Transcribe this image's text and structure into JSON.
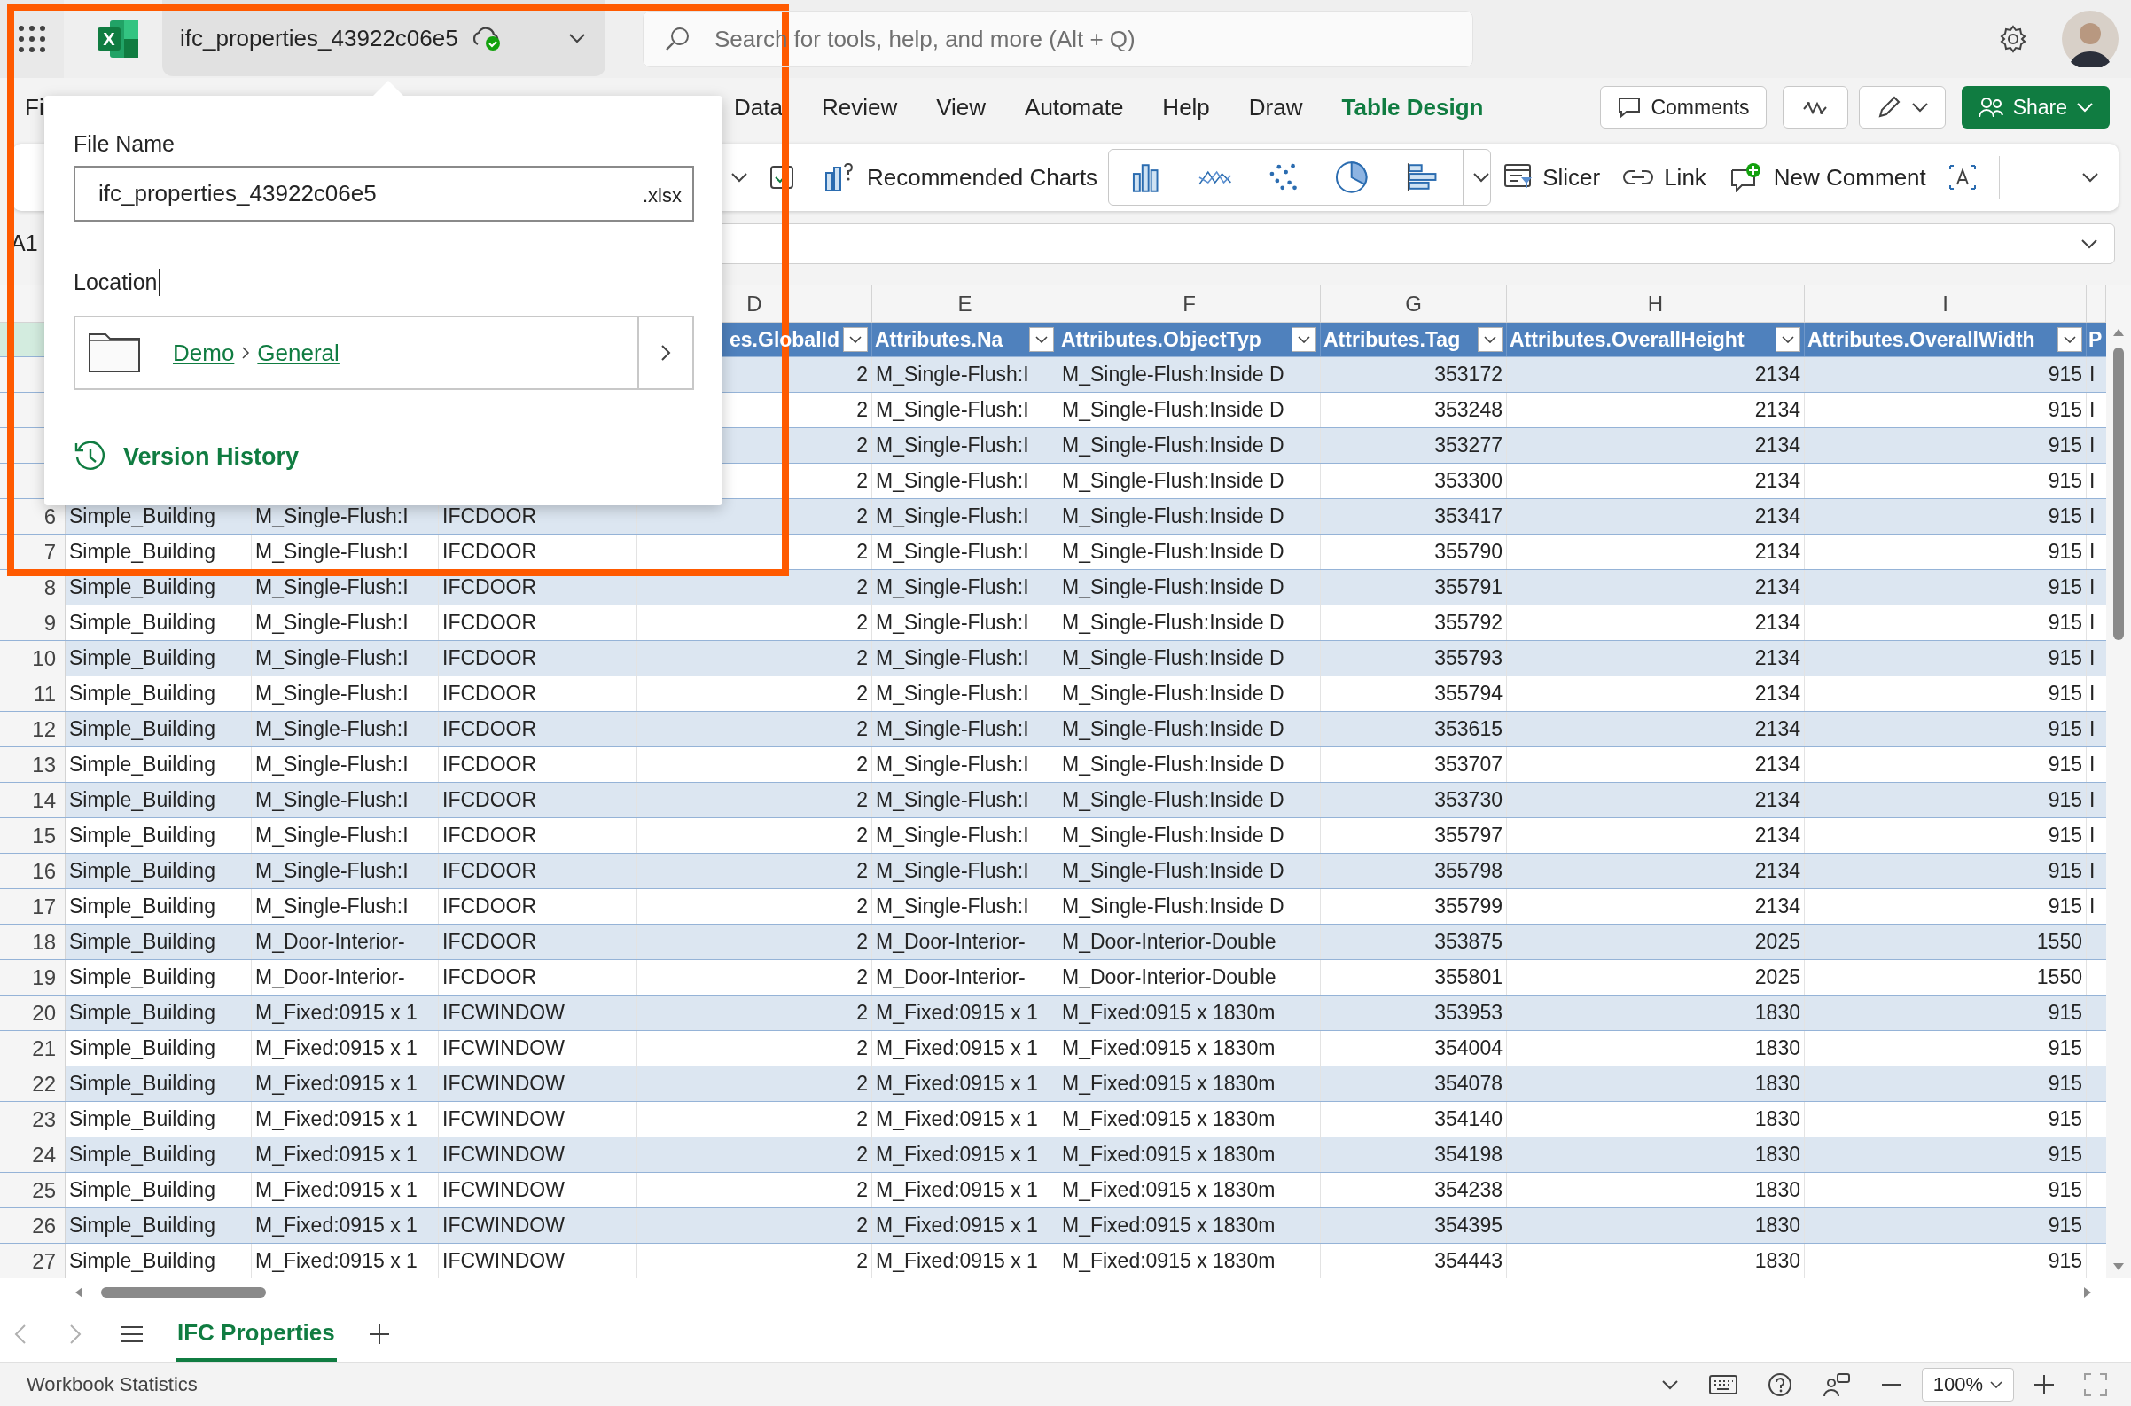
{
  "app_bar": {
    "logo_letter": "X",
    "file_name": "ifc_properties_43922c06e5",
    "search": {
      "placeholder": "Search for tools, help, and more (Alt + Q)"
    }
  },
  "ribbon_tabs": [
    {
      "label": "Fi",
      "selected": false
    },
    {
      "label": "Data",
      "selected": false
    },
    {
      "label": "Review",
      "selected": false
    },
    {
      "label": "View",
      "selected": false
    },
    {
      "label": "Automate",
      "selected": false
    },
    {
      "label": "Help",
      "selected": false
    },
    {
      "label": "Draw",
      "selected": false
    },
    {
      "label": "Table Design",
      "selected": true
    }
  ],
  "ribbon_buttons": {
    "comments": "Comments",
    "share": "Share"
  },
  "toolbar": {
    "recommended_charts": "Recommended Charts",
    "slicer": "Slicer",
    "link": "Link",
    "new_comment": "New Comment"
  },
  "name_box": "A1",
  "column_letters": [
    "D",
    "E",
    "F",
    "G",
    "H",
    "I"
  ],
  "header_row": {
    "under_popup": true,
    "active": true,
    "cells": [
      "es.GlobalId",
      "Attributes.Na",
      "Attributes.ObjectTyp",
      "Attributes.Tag",
      "Attributes.OverallHeight",
      "Attributes.OverallWidth",
      "P"
    ]
  },
  "rows": [
    {
      "under_popup": true,
      "cells": [
        "2",
        "M_Single-Flush:I",
        "M_Single-Flush:Inside D",
        "353172",
        "2134",
        "915",
        "I"
      ]
    },
    {
      "under_popup": true,
      "cells": [
        "2",
        "M_Single-Flush:I",
        "M_Single-Flush:Inside D",
        "353248",
        "2134",
        "915",
        "I"
      ]
    },
    {
      "under_popup": true,
      "cells": [
        "2",
        "M_Single-Flush:I",
        "M_Single-Flush:Inside D",
        "353277",
        "2134",
        "915",
        "I"
      ]
    },
    {
      "under_popup": true,
      "cells": [
        "2",
        "M_Single-Flush:I",
        "M_Single-Flush:Inside D",
        "353300",
        "2134",
        "915",
        "I"
      ]
    },
    {
      "number": "6",
      "under_popup": false,
      "cells": [
        "Simple_Building",
        "M_Single-Flush:I",
        "IFCDOOR",
        "2",
        "M_Single-Flush:I",
        "M_Single-Flush:Inside D",
        "353417",
        "2134",
        "915",
        "I"
      ]
    },
    {
      "number": "7",
      "under_popup": false,
      "cells": [
        "Simple_Building",
        "M_Single-Flush:I",
        "IFCDOOR",
        "2",
        "M_Single-Flush:I",
        "M_Single-Flush:Inside D",
        "355790",
        "2134",
        "915",
        "I"
      ]
    },
    {
      "number": "8",
      "under_popup": false,
      "cells": [
        "Simple_Building",
        "M_Single-Flush:I",
        "IFCDOOR",
        "2",
        "M_Single-Flush:I",
        "M_Single-Flush:Inside D",
        "355791",
        "2134",
        "915",
        "I"
      ]
    },
    {
      "number": "9",
      "under_popup": false,
      "cells": [
        "Simple_Building",
        "M_Single-Flush:I",
        "IFCDOOR",
        "2",
        "M_Single-Flush:I",
        "M_Single-Flush:Inside D",
        "355792",
        "2134",
        "915",
        "I"
      ]
    },
    {
      "number": "10",
      "under_popup": false,
      "cells": [
        "Simple_Building",
        "M_Single-Flush:I",
        "IFCDOOR",
        "2",
        "M_Single-Flush:I",
        "M_Single-Flush:Inside D",
        "355793",
        "2134",
        "915",
        "I"
      ]
    },
    {
      "number": "11",
      "under_popup": false,
      "cells": [
        "Simple_Building",
        "M_Single-Flush:I",
        "IFCDOOR",
        "2",
        "M_Single-Flush:I",
        "M_Single-Flush:Inside D",
        "355794",
        "2134",
        "915",
        "I"
      ]
    },
    {
      "number": "12",
      "under_popup": false,
      "cells": [
        "Simple_Building",
        "M_Single-Flush:I",
        "IFCDOOR",
        "2",
        "M_Single-Flush:I",
        "M_Single-Flush:Inside D",
        "353615",
        "2134",
        "915",
        "I"
      ]
    },
    {
      "number": "13",
      "under_popup": false,
      "cells": [
        "Simple_Building",
        "M_Single-Flush:I",
        "IFCDOOR",
        "2",
        "M_Single-Flush:I",
        "M_Single-Flush:Inside D",
        "353707",
        "2134",
        "915",
        "I"
      ]
    },
    {
      "number": "14",
      "under_popup": false,
      "cells": [
        "Simple_Building",
        "M_Single-Flush:I",
        "IFCDOOR",
        "2",
        "M_Single-Flush:I",
        "M_Single-Flush:Inside D",
        "353730",
        "2134",
        "915",
        "I"
      ]
    },
    {
      "number": "15",
      "under_popup": false,
      "cells": [
        "Simple_Building",
        "M_Single-Flush:I",
        "IFCDOOR",
        "2",
        "M_Single-Flush:I",
        "M_Single-Flush:Inside D",
        "355797",
        "2134",
        "915",
        "I"
      ]
    },
    {
      "number": "16",
      "under_popup": false,
      "cells": [
        "Simple_Building",
        "M_Single-Flush:I",
        "IFCDOOR",
        "2",
        "M_Single-Flush:I",
        "M_Single-Flush:Inside D",
        "355798",
        "2134",
        "915",
        "I"
      ]
    },
    {
      "number": "17",
      "under_popup": false,
      "cells": [
        "Simple_Building",
        "M_Single-Flush:I",
        "IFCDOOR",
        "2",
        "M_Single-Flush:I",
        "M_Single-Flush:Inside D",
        "355799",
        "2134",
        "915",
        "I"
      ]
    },
    {
      "number": "18",
      "under_popup": false,
      "cells": [
        "Simple_Building",
        "M_Door-Interior-",
        "IFCDOOR",
        "2",
        "M_Door-Interior-",
        "M_Door-Interior-Double",
        "353875",
        "2025",
        "1550"
      ]
    },
    {
      "number": "19",
      "under_popup": false,
      "cells": [
        "Simple_Building",
        "M_Door-Interior-",
        "IFCDOOR",
        "2",
        "M_Door-Interior-",
        "M_Door-Interior-Double",
        "355801",
        "2025",
        "1550"
      ]
    },
    {
      "number": "20",
      "under_popup": false,
      "cells": [
        "Simple_Building",
        "M_Fixed:0915 x 1",
        "IFCWINDOW",
        "2",
        "M_Fixed:0915 x 1",
        "M_Fixed:0915 x 1830m",
        "353953",
        "1830",
        "915"
      ]
    },
    {
      "number": "21",
      "under_popup": false,
      "cells": [
        "Simple_Building",
        "M_Fixed:0915 x 1",
        "IFCWINDOW",
        "2",
        "M_Fixed:0915 x 1",
        "M_Fixed:0915 x 1830m",
        "354004",
        "1830",
        "915"
      ]
    },
    {
      "number": "22",
      "under_popup": false,
      "cells": [
        "Simple_Building",
        "M_Fixed:0915 x 1",
        "IFCWINDOW",
        "2",
        "M_Fixed:0915 x 1",
        "M_Fixed:0915 x 1830m",
        "354078",
        "1830",
        "915"
      ]
    },
    {
      "number": "23",
      "under_popup": false,
      "cells": [
        "Simple_Building",
        "M_Fixed:0915 x 1",
        "IFCWINDOW",
        "2",
        "M_Fixed:0915 x 1",
        "M_Fixed:0915 x 1830m",
        "354140",
        "1830",
        "915"
      ]
    },
    {
      "number": "24",
      "under_popup": false,
      "cells": [
        "Simple_Building",
        "M_Fixed:0915 x 1",
        "IFCWINDOW",
        "2",
        "M_Fixed:0915 x 1",
        "M_Fixed:0915 x 1830m",
        "354198",
        "1830",
        "915"
      ]
    },
    {
      "number": "25",
      "under_popup": false,
      "cells": [
        "Simple_Building",
        "M_Fixed:0915 x 1",
        "IFCWINDOW",
        "2",
        "M_Fixed:0915 x 1",
        "M_Fixed:0915 x 1830m",
        "354238",
        "1830",
        "915"
      ]
    },
    {
      "number": "26",
      "under_popup": false,
      "cells": [
        "Simple_Building",
        "M_Fixed:0915 x 1",
        "IFCWINDOW",
        "2",
        "M_Fixed:0915 x 1",
        "M_Fixed:0915 x 1830m",
        "354395",
        "1830",
        "915"
      ]
    },
    {
      "number": "27",
      "under_popup": false,
      "cells": [
        "Simple_Building",
        "M_Fixed:0915 x 1",
        "IFCWINDOW",
        "2",
        "M_Fixed:0915 x 1",
        "M_Fixed:0915 x 1830m",
        "354443",
        "1830",
        "915"
      ]
    }
  ],
  "sheet_tabs": [
    {
      "label": "IFC Properties",
      "selected": true
    }
  ],
  "status_bar": {
    "text": "Workbook Statistics",
    "zoom": "100%"
  },
  "popup": {
    "file_name_label": "File Name",
    "file_name": "ifc_properties_43922c06e5",
    "extension": ".xlsx",
    "location_label": "Location",
    "path": [
      "Demo",
      "General"
    ],
    "version_history": "Version History"
  }
}
